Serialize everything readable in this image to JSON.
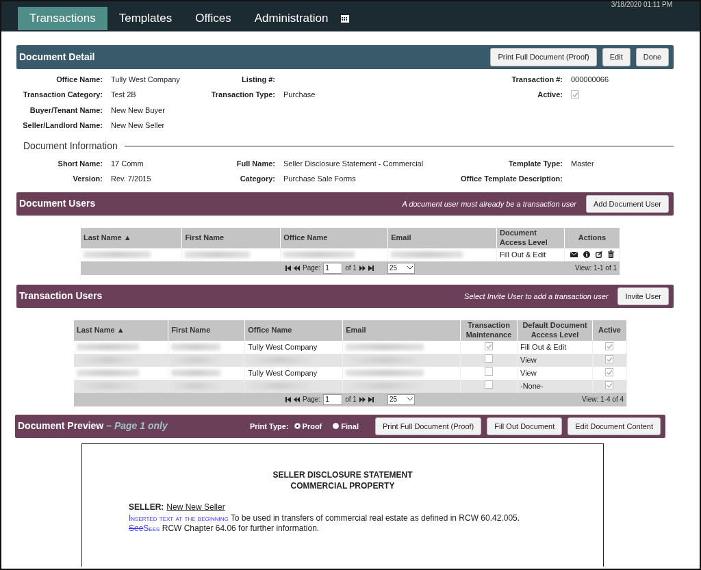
{
  "timestamp": "3/18/2020 01:11 PM",
  "tabs": [
    {
      "label": "Transactions",
      "selected": true
    },
    {
      "label": "Templates",
      "selected": false
    },
    {
      "label": "Offices",
      "selected": false
    },
    {
      "label": "Administration",
      "selected": false
    }
  ],
  "detail": {
    "title": "Document Detail",
    "buttons": [
      "Print Full Document (Proof)",
      "Edit",
      "Done"
    ],
    "columns": [
      [
        {
          "label": "Office Name:",
          "value": "Tully West Company"
        },
        {
          "label": "Transaction Category:",
          "value": "Test 2B"
        },
        {
          "label": "Buyer/Tenant Name:",
          "value": "New New Buyer"
        },
        {
          "label": "Seller/Landlord Name:",
          "value": "New New Seller"
        }
      ],
      [
        {
          "label": "Listing #:"
        },
        {
          "label": "Transaction Type:",
          "value": "Purchase"
        }
      ],
      [
        {
          "label": "Transaction #:",
          "value": "000000066"
        },
        {
          "label": "Active:",
          "checked": true
        }
      ]
    ]
  },
  "info": {
    "title": "Document Information",
    "columns": [
      [
        {
          "label": "Short Name:",
          "value": "17 Comm"
        },
        {
          "label": "Version:",
          "value": "Rev. 7/2015"
        }
      ],
      [
        {
          "label": "Full Name:",
          "value": "Seller Disclosure Statement - Commercial"
        },
        {
          "label": "Category:",
          "value": "Purchase Sale Forms"
        }
      ],
      [
        {
          "label": "Template Type:",
          "value": "Master"
        },
        {
          "label": "Office Template Description:"
        }
      ]
    ]
  },
  "document_users": {
    "title": "Document Users",
    "note": "A document user must already be a transaction user",
    "button": "Add Document User",
    "columns": [
      "Last Name ▲",
      "First Name",
      "Office Name",
      "Email",
      "Document Access Level",
      "Actions"
    ],
    "rows": [
      [
        {
          "kind": "blurred"
        },
        {
          "kind": "blurred"
        },
        {
          "kind": "blurred"
        },
        {
          "kind": "blurred"
        },
        {
          "kind": "text",
          "text": "Fill Out & Edit"
        },
        {
          "kind": "actions"
        }
      ]
    ],
    "pager": {
      "page_label": "Page:",
      "page": "1",
      "of": "of 1",
      "page_size": "25",
      "view": "View: 1-1 of 1"
    }
  },
  "transaction_users": {
    "title": "Transaction Users",
    "note": "Select Invite User to add a transaction user",
    "button": "Invite User",
    "columns": [
      "Last Name ▲",
      "First Name",
      "Office Name",
      "Email",
      "Transaction Maintenance",
      "Default Document Access Level",
      "Active"
    ],
    "rows": [
      [
        {
          "kind": "blurred"
        },
        {
          "kind": "blurred"
        },
        {
          "kind": "text",
          "text": "Tully West Company"
        },
        {
          "kind": "blurred"
        },
        {
          "kind": "check",
          "checked": true
        },
        {
          "kind": "text",
          "text": "Fill Out & Edit"
        },
        {
          "kind": "check",
          "checked": true
        }
      ],
      [
        {
          "kind": "blurred"
        },
        {
          "kind": "blurred"
        },
        {
          "kind": "blurred"
        },
        {
          "kind": "blurred"
        },
        {
          "kind": "check",
          "checked": false
        },
        {
          "kind": "text",
          "text": "View"
        },
        {
          "kind": "check",
          "checked": true
        }
      ],
      [
        {
          "kind": "blurred"
        },
        {
          "kind": "blurred"
        },
        {
          "kind": "text",
          "text": "Tully West Company"
        },
        {
          "kind": "blurred"
        },
        {
          "kind": "check",
          "checked": false
        },
        {
          "kind": "text",
          "text": "View"
        },
        {
          "kind": "check",
          "checked": true
        }
      ],
      [
        {
          "kind": "blurred"
        },
        {
          "kind": "blurred"
        },
        {
          "kind": "blurred"
        },
        {
          "kind": "blurred"
        },
        {
          "kind": "check",
          "checked": false
        },
        {
          "kind": "text",
          "text": "-None-"
        },
        {
          "kind": "check",
          "checked": true
        }
      ]
    ],
    "pager": {
      "page_label": "Page:",
      "page": "1",
      "of": "of 1",
      "page_size": "25",
      "view": "View: 1-4 of 4"
    }
  },
  "preview": {
    "title": "Document Preview",
    "subtitle": "– Page 1 only",
    "print_type_label": "Print Type:",
    "print_types": [
      {
        "label": "Proof",
        "selected": true
      },
      {
        "label": "Final",
        "selected": false
      }
    ],
    "buttons": [
      "Print Full Document (Proof)",
      "Fill Out Document",
      "Edit Document Content"
    ],
    "document": {
      "heading": [
        "SELLER DISCLOSURE STATEMENT",
        "COMMERCIAL PROPERTY"
      ],
      "seller_label": "SELLER:",
      "seller_value": "New New Seller",
      "paragraph": [
        {
          "kind": "inserted",
          "text": "Inserted text at the beginning"
        },
        {
          "kind": "plain",
          "text": " To be used in transfers of commercial real estate as defined in RCW 60.42.005."
        },
        {
          "kind": "break"
        },
        {
          "kind": "deleted",
          "text": "See"
        },
        {
          "kind": "inserted",
          "text": "Sees"
        },
        {
          "kind": "plain",
          "text": " RCW Chapter 64.06 for further information."
        }
      ]
    }
  }
}
